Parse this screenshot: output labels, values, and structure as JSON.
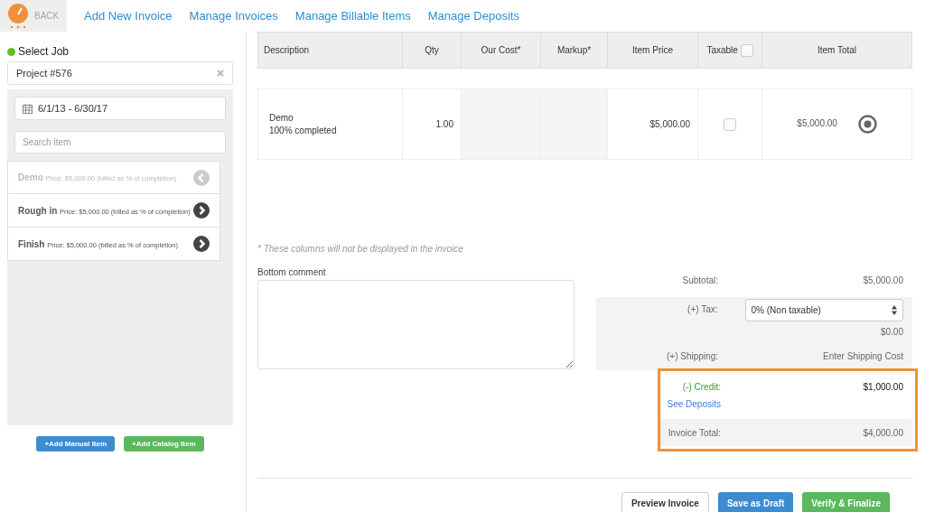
{
  "nav": {
    "back": "BACK",
    "links": [
      {
        "label": "Add New Invoice"
      },
      {
        "label": "Manage Invoices"
      },
      {
        "label": "Manage Billable Items"
      },
      {
        "label": "Manage Deposits"
      }
    ]
  },
  "sidebar": {
    "select_job_label": "Select Job",
    "job": "Project #576",
    "date_range": "6/1/13 - 6/30/17",
    "search_placeholder": "Search item",
    "items": [
      {
        "name": "Demo",
        "price": "Price: $5,000.00 (billed as % of completion)",
        "added": true
      },
      {
        "name": "Rough in",
        "price": "Price: $5,000.00 (billed as % of completion)",
        "added": false
      },
      {
        "name": "Finish",
        "price": "Price: $5,000.00 (billed as % of completion)",
        "added": false
      }
    ],
    "buttons": [
      {
        "label": "+Add Manual Item",
        "kind": "primary"
      },
      {
        "label": "+Add Catalog Item",
        "kind": "success"
      }
    ]
  },
  "table": {
    "columns": [
      "Description",
      "Qty",
      "Our Cost*",
      "Markup*",
      "Item Price",
      "Taxable",
      "Item Total"
    ],
    "taxable_all_checked": false,
    "rows": [
      {
        "description": "Demo",
        "progress": "100% completed",
        "qty": "1.00",
        "item_price": "$5,000.00",
        "taxable": false,
        "item_total": "$5,000.00"
      }
    ]
  },
  "note": "* These columns will not be displayed in the invoice",
  "bottom_comment": {
    "label": "Bottom comment"
  },
  "summary": {
    "subtotal_label": "Subtotal:",
    "subtotal": "$5,000.00",
    "tax_label": "(+) Tax:",
    "tax_option": "0% (Non taxable)",
    "tax_amount": "$0.00",
    "shipping_label": "(+) Shipping:",
    "shipping_placeholder": "Enter Shipping Cost",
    "credit_label": "(-) Credit:",
    "credit": "$1,000.00",
    "see_deposits": "See Deposits",
    "total_label": "Invoice Total:",
    "total": "$4,000.00"
  },
  "actions": [
    {
      "label": "Preview Invoice",
      "kind": "default"
    },
    {
      "label": "Save as Draft",
      "kind": "primary"
    },
    {
      "label": "Verify & Finalize",
      "kind": "success"
    }
  ]
}
